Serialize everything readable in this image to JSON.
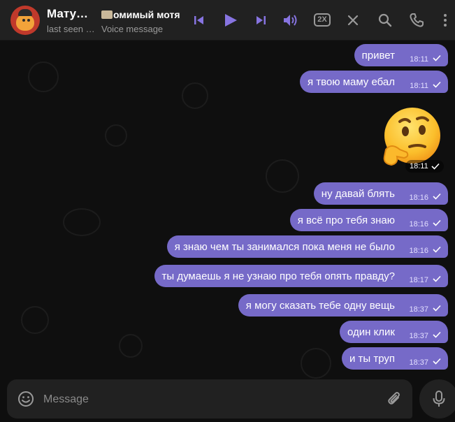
{
  "header": {
    "title": "Мату…",
    "subtitle": "last seen …",
    "track_title": "омимый мотя",
    "track_subtitle": "Voice message",
    "speed": "2X",
    "avatar_icon": "red-cartoon-avatar",
    "icons": [
      "skip-previous-icon",
      "play-icon",
      "skip-next-icon",
      "volume-icon",
      "close-icon",
      "search-icon",
      "phone-icon",
      "more-vertical-icon"
    ]
  },
  "messages": [
    {
      "text": "привет",
      "time": "18:11"
    },
    {
      "text": "я твою маму ебал",
      "time": "18:11"
    },
    {
      "emoji": "thinking-face",
      "time": "18:11"
    },
    {
      "text": "ну давай блять",
      "time": "18:16"
    },
    {
      "text": "я всё про тебя знаю",
      "time": "18:16"
    },
    {
      "text": "я знаю чем ты занимался пока меня не было",
      "time": "18:16"
    },
    {
      "text": "ты думаешь я не узнаю про тебя опять правду?",
      "time": "18:17"
    },
    {
      "text": "я могу сказать тебе одну вещь",
      "time": "18:37"
    },
    {
      "text": "один клик",
      "time": "18:37"
    },
    {
      "text": "и ты труп",
      "time": "18:37"
    }
  ],
  "composer": {
    "placeholder": "Message"
  },
  "colors": {
    "accent": "#8774e1",
    "bubble": "#766ac8",
    "header_bg": "#212121",
    "chat_bg": "#0f0f0f"
  }
}
